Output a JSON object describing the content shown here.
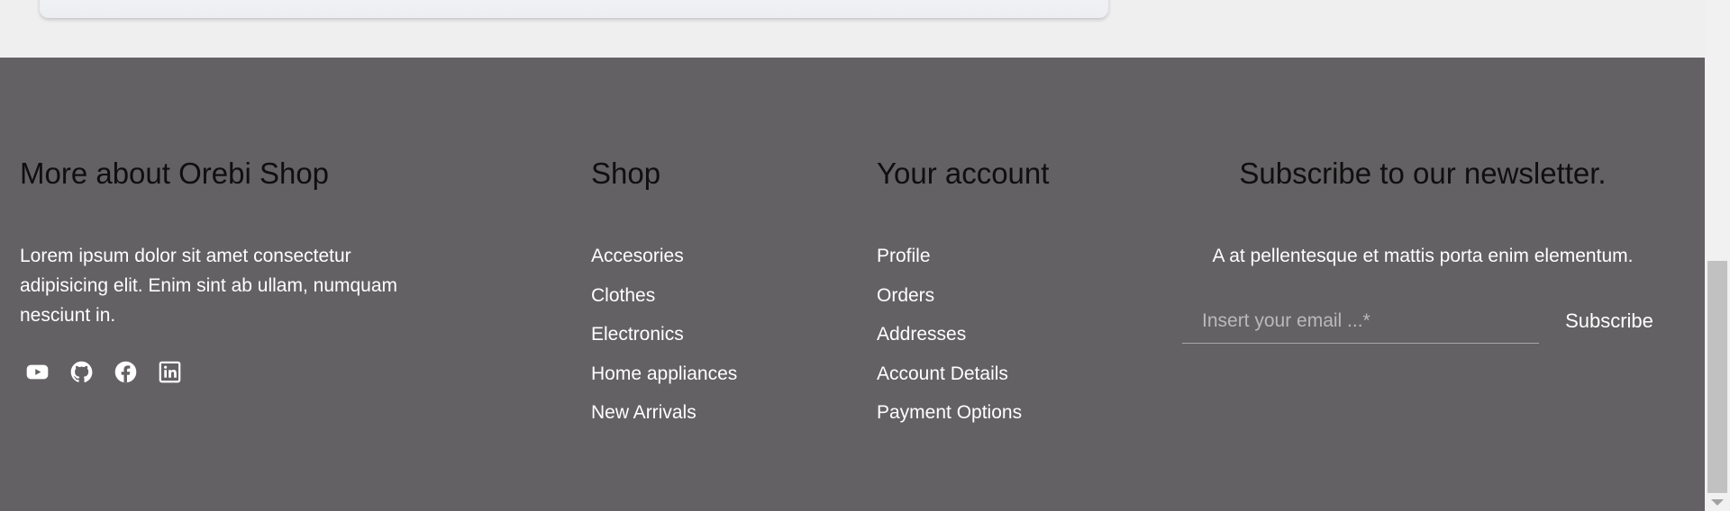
{
  "footer": {
    "about": {
      "heading": "More about Orebi Shop",
      "text": "Lorem ipsum dolor sit amet consectetur adipisicing elit. Enim sint ab ullam, numquam nesciunt in.",
      "socials": [
        "youtube-icon",
        "github-icon",
        "facebook-icon",
        "linkedin-icon"
      ]
    },
    "shop": {
      "heading": "Shop",
      "links": [
        "Accesories",
        "Clothes",
        "Electronics",
        "Home appliances",
        "New Arrivals"
      ]
    },
    "account": {
      "heading": "Your account",
      "links": [
        "Profile",
        "Orders",
        "Addresses",
        "Account Details",
        "Payment Options"
      ]
    },
    "newsletter": {
      "heading": "Subscribe to our newsletter.",
      "text": "A at pellentesque et mattis porta enim elementum.",
      "email_placeholder": "Insert your email ...*",
      "email_value": "",
      "subscribe_label": "Subscribe"
    }
  },
  "colors": {
    "footer_bg": "#636163",
    "heading_text": "#0f0f0f",
    "body_text": "#ffffff"
  }
}
